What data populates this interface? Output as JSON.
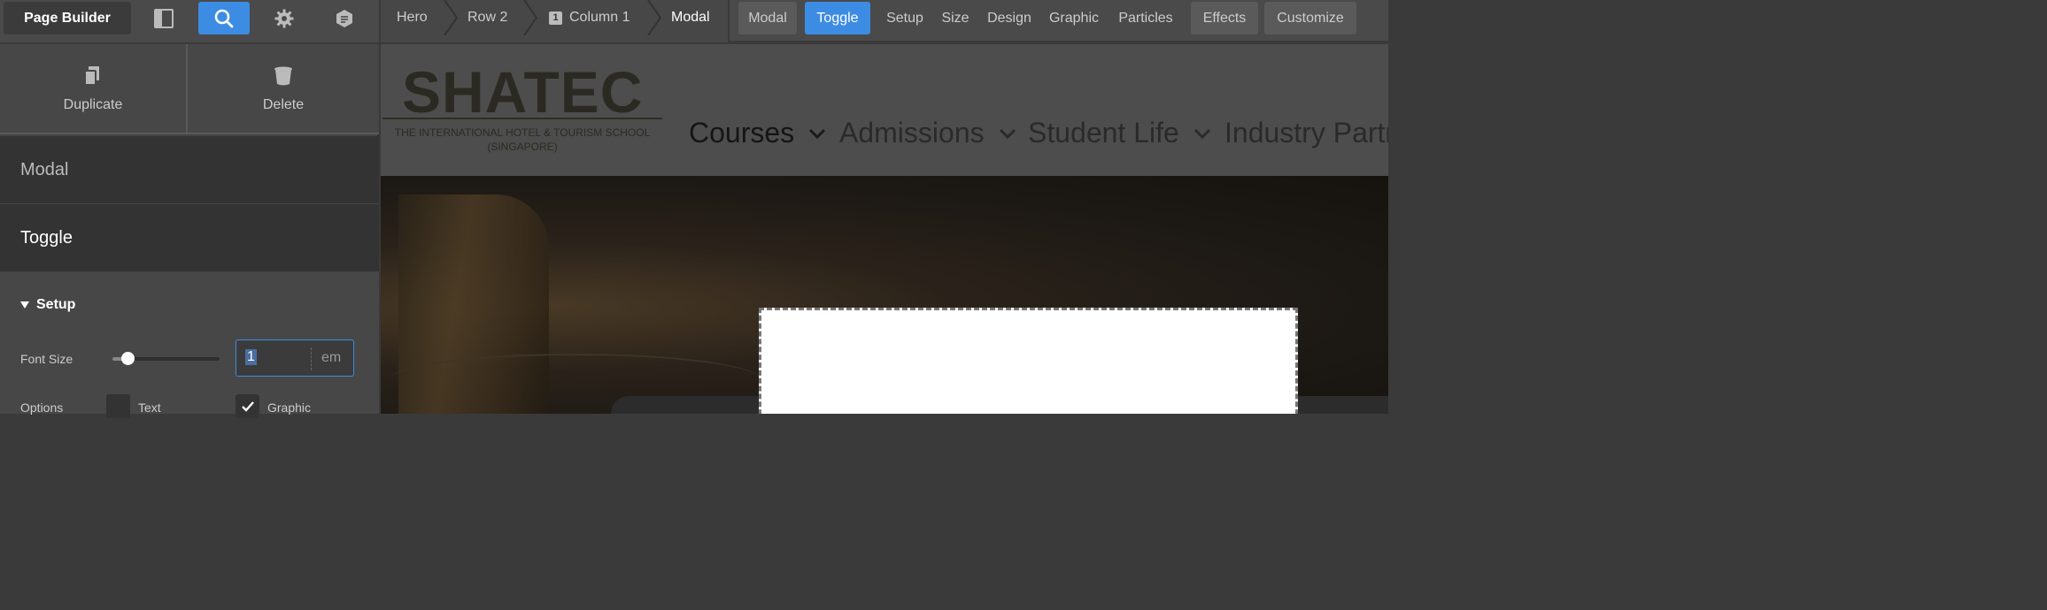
{
  "topbar": {
    "app_title": "Page Builder",
    "icons": [
      "layout-panel-icon",
      "search-icon",
      "gear-icon",
      "notes-icon"
    ]
  },
  "breadcrumbs": [
    {
      "label": "Hero"
    },
    {
      "label": "Row 2"
    },
    {
      "label": "Column 1",
      "badge": "1"
    },
    {
      "label": "Modal"
    }
  ],
  "tabs": [
    "Modal",
    "Toggle",
    "Setup",
    "Size",
    "Design",
    "Graphic",
    "Particles",
    "Effects",
    "Customize"
  ],
  "actions": {
    "duplicate": "Duplicate",
    "delete": "Delete"
  },
  "panel": {
    "modal": "Modal",
    "toggle": "Toggle",
    "setup_title": "Setup",
    "font_size_label": "Font Size",
    "font_size_value": "1",
    "font_size_unit": "em",
    "font_size_slider_fraction": 0.14,
    "options_label": "Options",
    "option_text": "Text",
    "option_graphic": "Graphic",
    "option_text_checked": false,
    "option_graphic_checked": true
  },
  "site": {
    "logo": "SHATEC",
    "logo_sub_line1": "THE INTERNATIONAL HOTEL & TOURISM SCHOOL",
    "logo_sub_line2": "(SINGAPORE)",
    "nav": [
      "Courses",
      "Admissions",
      "Student Life",
      "Industry Partn"
    ]
  },
  "colors": {
    "accent": "#3d8ce3",
    "topbar": "#4a4a4a",
    "panel": "#444444"
  }
}
